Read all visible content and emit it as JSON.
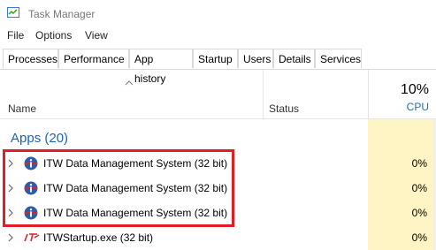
{
  "window": {
    "title": "Task Manager"
  },
  "menu": [
    "File",
    "Options",
    "View"
  ],
  "tabs": [
    "Processes",
    "Performance",
    "App history",
    "Startup",
    "Users",
    "Details",
    "Services"
  ],
  "active_tab": "Processes",
  "columns": {
    "name": "Name",
    "status": "Status",
    "cpu_percent": "10%",
    "cpu_label": "CPU"
  },
  "group": {
    "label": "Apps (20)"
  },
  "rows": [
    {
      "name": "ITW Data Management System (32 bit)",
      "cpu": "0%",
      "icon": "info-globe-icon"
    },
    {
      "name": "ITW Data Management System (32 bit)",
      "cpu": "0%",
      "icon": "info-globe-icon"
    },
    {
      "name": "ITW Data Management System (32 bit)",
      "cpu": "0%",
      "icon": "info-globe-icon"
    },
    {
      "name": "ITWStartup.exe (32 bit)",
      "cpu": "0%",
      "icon": "itw-logo-icon"
    }
  ],
  "colors": {
    "highlight": "#e21d23",
    "cpu_heat": "#fff4c4",
    "group_text": "#1a63b8"
  }
}
